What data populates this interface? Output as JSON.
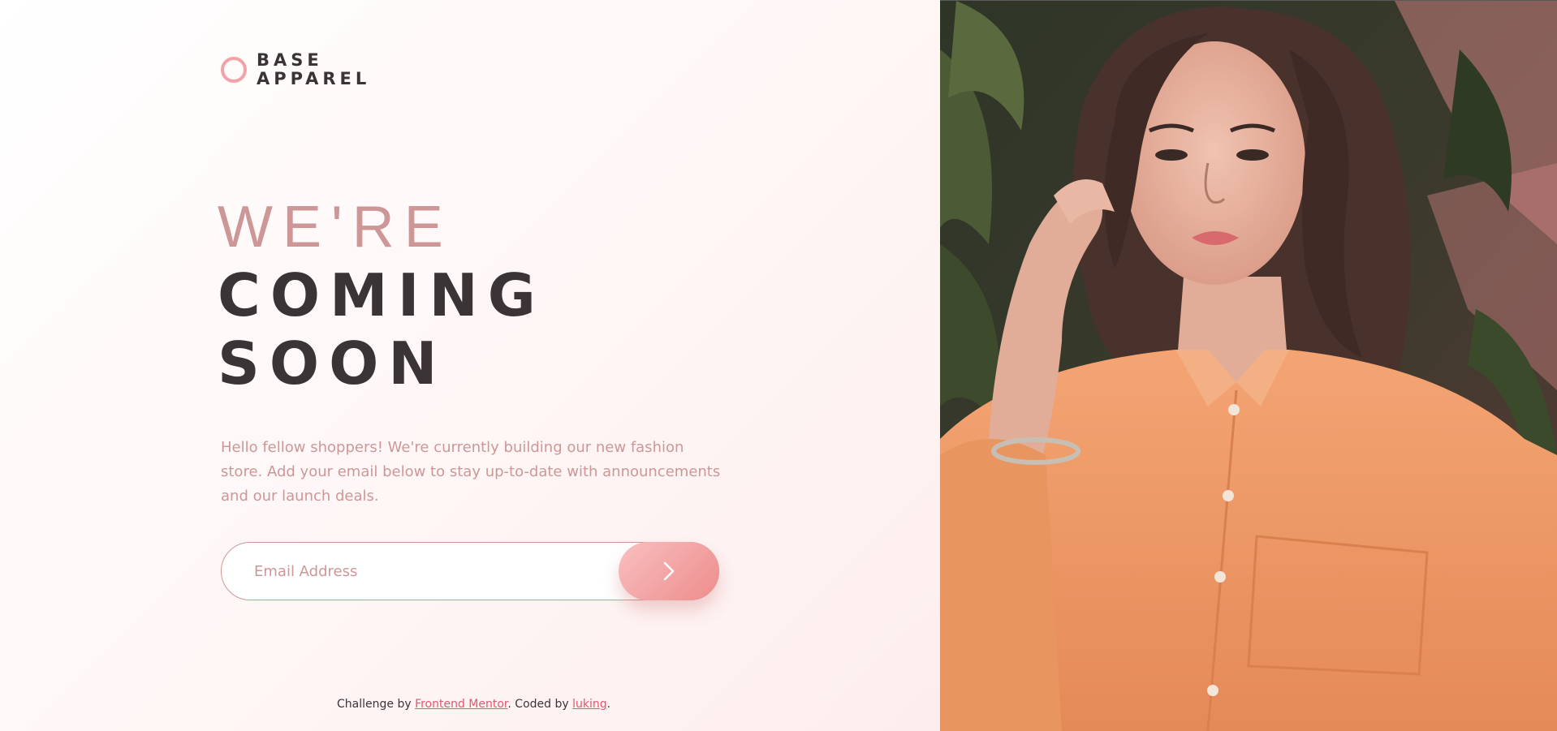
{
  "brand": {
    "line1": "BASE",
    "line2": "APPAREL",
    "accent": "#f2a3a8"
  },
  "hero": {
    "line1": "WE'RE",
    "line2": "COMING",
    "line3": "SOON"
  },
  "description": "Hello fellow shoppers! We're currently building our new fashion store. Add your email below to stay up-to-date with announcements and our launch deals.",
  "form": {
    "email_placeholder": "Email Address",
    "submit_icon": "arrow-right-icon"
  },
  "footer": {
    "prefix": "Challenge by ",
    "link1": "Frontend Mentor",
    "middle": ". Coded by ",
    "link2": "luking",
    "suffix": "."
  },
  "colors": {
    "desaturated_red": "#ce9797",
    "soft_red": "#f96262",
    "dark_grayish_red": "#3b3436"
  },
  "hero_image": "woman-in-orange-shirt-photo"
}
